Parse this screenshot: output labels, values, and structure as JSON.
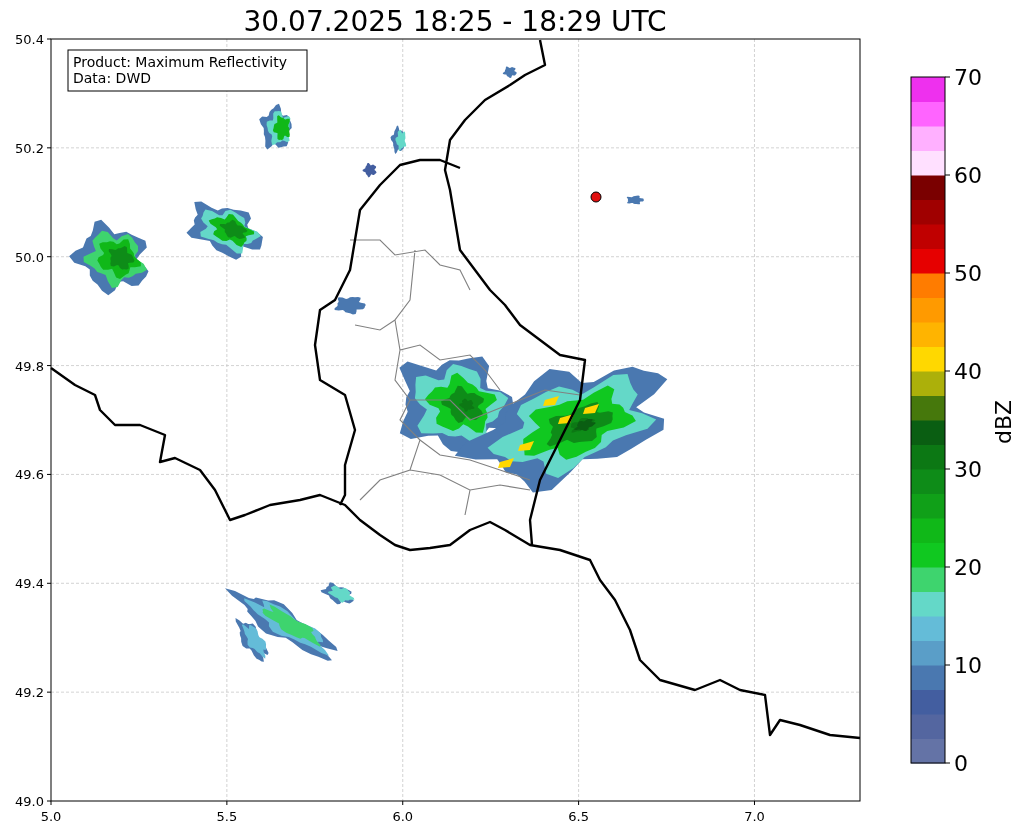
{
  "title": "30.07.2025 18:25 - 18:29 UTC",
  "info_box": [
    "Product: Maximum Reflectivity",
    "Data: DWD"
  ],
  "x_axis": {
    "ticks": [
      "5.0",
      "5.5",
      "6.0",
      "6.5",
      "7.0"
    ]
  },
  "y_axis": {
    "ticks": [
      "50.4",
      "50.2",
      "50.0",
      "49.8",
      "49.6",
      "49.4",
      "49.2",
      "49.0"
    ]
  },
  "colorbar": {
    "label": "dBZ",
    "ticks": [
      "70",
      "60",
      "50",
      "40",
      "30",
      "20",
      "10",
      "0"
    ],
    "bins": [
      {
        "color": "#6473a6"
      },
      {
        "color": "#5466a0"
      },
      {
        "color": "#435ea0"
      },
      {
        "color": "#4a78b0"
      },
      {
        "color": "#5a9ec8"
      },
      {
        "color": "#64bcd8"
      },
      {
        "color": "#64d8c8"
      },
      {
        "color": "#3ed46e"
      },
      {
        "color": "#10c820"
      },
      {
        "color": "#10b818"
      },
      {
        "color": "#10a018"
      },
      {
        "color": "#0e8c18"
      },
      {
        "color": "#0c7814"
      },
      {
        "color": "#0a5e12"
      },
      {
        "color": "#46780c"
      },
      {
        "color": "#acb00a"
      },
      {
        "color": "#ffd800"
      },
      {
        "color": "#ffb400"
      },
      {
        "color": "#ff9a00"
      },
      {
        "color": "#ff7c00"
      },
      {
        "color": "#e60000"
      },
      {
        "color": "#c00000"
      },
      {
        "color": "#a00000"
      },
      {
        "color": "#7a0000"
      },
      {
        "color": "#ffe0ff"
      },
      {
        "color": "#ffb0ff"
      },
      {
        "color": "#ff64ff"
      },
      {
        "color": "#ee30ee"
      }
    ]
  }
}
